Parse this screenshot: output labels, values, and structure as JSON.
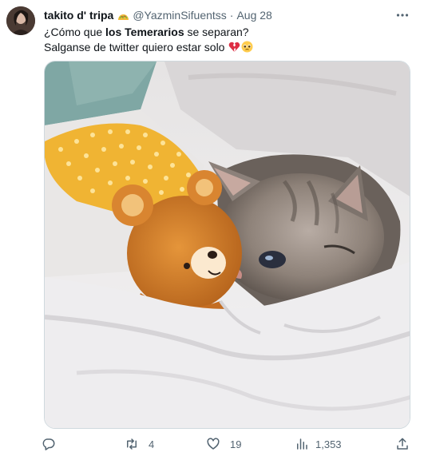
{
  "tweet": {
    "display_name": "takito d' tripa",
    "handle": "@YazminSifuentss",
    "separator": "·",
    "date": "Aug 28",
    "text_line1_prefix": "¿Cómo que ",
    "text_line1_bold": "los Temerarios",
    "text_line1_suffix": " se separan?",
    "text_line2": "Salganse de twitter quiero estar solo",
    "icons": {
      "name_badge": "taco-emoji-icon",
      "broken_heart": "broken-heart-emoji-icon",
      "pleading_face": "pleading-face-emoji-icon"
    }
  },
  "actions": {
    "reply_count": "",
    "retweet_count": "4",
    "like_count": "19",
    "views_count": "1,353"
  },
  "colors": {
    "secondary_text": "#536471",
    "primary_text": "#0f1419",
    "border": "#cfd9de"
  }
}
